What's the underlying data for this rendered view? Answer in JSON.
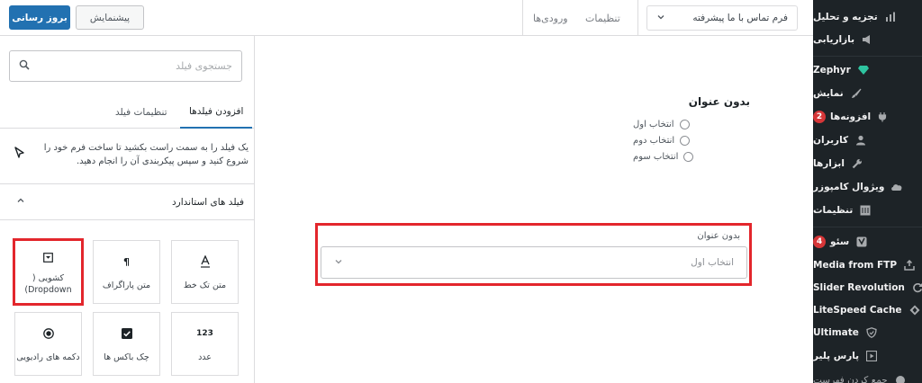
{
  "toolbar": {
    "publish_label": "بروز رسانی",
    "preview_label": "پیشنمایش",
    "nav_entries": "ورودی‌ها",
    "nav_settings": "تنظیمات",
    "form_select_value": "فرم تماس با ما پیشرفته"
  },
  "panel": {
    "search_placeholder": "جستجوی فیلد",
    "tab_add_fields": "افزودن فیلدها",
    "tab_field_settings": "تنظیمات فیلد",
    "hint": "یک فیلد را به سمت راست بکشید تا ساخت فرم خود را شروع کنید و سپس پیکربندی آن را انجام دهید.",
    "section_title": "فیلد های استاندارد",
    "fields": [
      {
        "label": "متن تک خط",
        "icon": "A"
      },
      {
        "label": "متن پاراگراف",
        "icon": "¶"
      },
      {
        "label": "کشویی ( Dropdown)",
        "icon": "dropdown-icon"
      },
      {
        "label": "عدد",
        "icon": "123"
      },
      {
        "label": "چک باکس ها",
        "icon": "checkbox-icon"
      },
      {
        "label": "دکمه های رادیویی",
        "icon": "radio-icon"
      }
    ]
  },
  "canvas": {
    "form_title": "بدون عنوان",
    "radio_options": [
      "انتخاب اول",
      "انتخاب دوم",
      "انتخاب سوم"
    ],
    "dropdown_label": "بدون عنوان",
    "dropdown_value": "انتخاب اول"
  },
  "sidebar": {
    "items": [
      {
        "label": "تجزیه و تحلیل",
        "icon": "chart-icon"
      },
      {
        "label": "بازاریابی",
        "icon": "megaphone-icon"
      },
      {
        "label": "Zephyr",
        "icon": "diamond-icon"
      },
      {
        "label": "نمایش",
        "icon": "brush-icon"
      },
      {
        "label": "افزونه‌ها",
        "icon": "plug-icon",
        "count": "2"
      },
      {
        "label": "کاربران",
        "icon": "user-icon"
      },
      {
        "label": "ابزارها",
        "icon": "wrench-icon"
      },
      {
        "label": "ویژوال کامپوزر",
        "icon": "cloud-icon"
      },
      {
        "label": "تنظیمات",
        "icon": "settings-icon"
      },
      {
        "label": "سئو",
        "icon": "yoast-icon",
        "count": "4"
      },
      {
        "label": "Media from FTP",
        "icon": "upload-icon"
      },
      {
        "label": "Slider Revolution",
        "icon": "refresh-icon"
      },
      {
        "label": "LiteSpeed Cache",
        "icon": "diamond-outline-icon"
      },
      {
        "label": "Ultimate",
        "icon": "shield-icon"
      },
      {
        "label": "پارس پلیر",
        "icon": "play-icon"
      },
      {
        "label": "جمع کردن فهرست",
        "icon": "collapse-icon"
      }
    ]
  },
  "colors": {
    "accent": "#2271b1",
    "sidebar_bg": "#1d2327",
    "highlight": "#e3262c",
    "badge": "#d63638"
  }
}
